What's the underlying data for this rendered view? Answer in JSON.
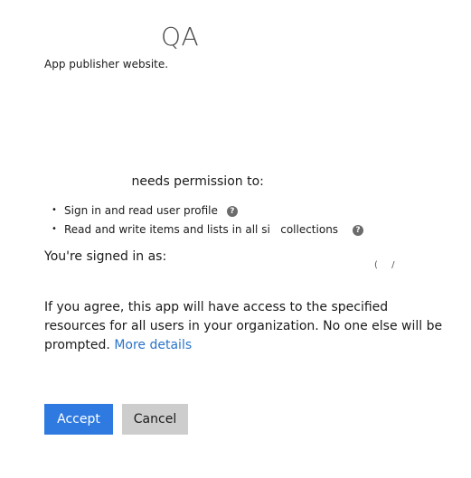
{
  "app": {
    "name": "QA",
    "publisher_link": "App publisher website."
  },
  "permissions": {
    "header": "needs permission to:",
    "bullet": "•",
    "items": [
      {
        "label": "Sign in and read user profile",
        "help_icon": "?"
      },
      {
        "label": "Read and write items and lists in all si   collections",
        "help_icon": "?"
      }
    ]
  },
  "signed_in": {
    "label": "You're signed in as:",
    "user": "( /"
  },
  "consent": {
    "text": "If you agree, this app will have access to the specified resources for all users in your organization. No one else will be prompted.",
    "more_details": "More details"
  },
  "buttons": {
    "accept": "Accept",
    "cancel": "Cancel"
  },
  "colors": {
    "accent": "#2f7ae0",
    "link": "#2a73c9",
    "cancel_bg": "#cdcdcd"
  }
}
